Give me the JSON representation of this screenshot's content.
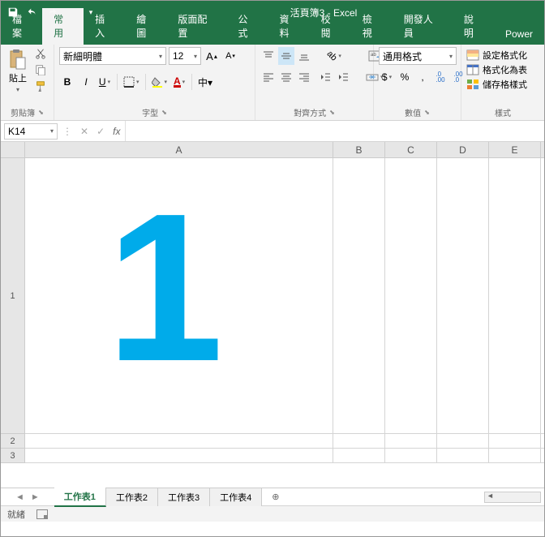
{
  "title": "活頁簿3 - Excel",
  "tabs": {
    "file": "檔案",
    "home": "常用",
    "insert": "插入",
    "draw": "繪圖",
    "layout": "版面配置",
    "formulas": "公式",
    "data": "資料",
    "review": "校閱",
    "view": "檢視",
    "developer": "開發人員",
    "help": "說明",
    "power": "Power"
  },
  "ribbon": {
    "clipboard": {
      "paste": "貼上",
      "label": "剪貼簿"
    },
    "font": {
      "name": "新細明體",
      "size": "12",
      "bold": "B",
      "italic": "I",
      "underline": "U",
      "phonetic": "中▾",
      "label": "字型"
    },
    "align": {
      "wrap_glyph": "ab",
      "label": "對齊方式"
    },
    "number": {
      "format": "通用格式",
      "currency": "$",
      "percent": "%",
      "comma": ",",
      "inc": ".0\n.00",
      "dec": ".00\n.0",
      "label": "數值"
    },
    "styles": {
      "conditional": "設定格式化",
      "table": "格式化為表",
      "cell": "儲存格樣式",
      "label": "樣式"
    }
  },
  "formula": {
    "cell_ref": "K14",
    "fx": "fx",
    "value": ""
  },
  "columns": {
    "A": "A",
    "B": "B",
    "C": "C",
    "D": "D",
    "E": "E"
  },
  "rows": {
    "r1": "1",
    "r2": "2",
    "r3": "3"
  },
  "cell_A1": "1",
  "sheets": {
    "s1": "工作表1",
    "s2": "工作表2",
    "s3": "工作表3",
    "s4": "工作表4"
  },
  "status": {
    "ready": "就緒"
  }
}
